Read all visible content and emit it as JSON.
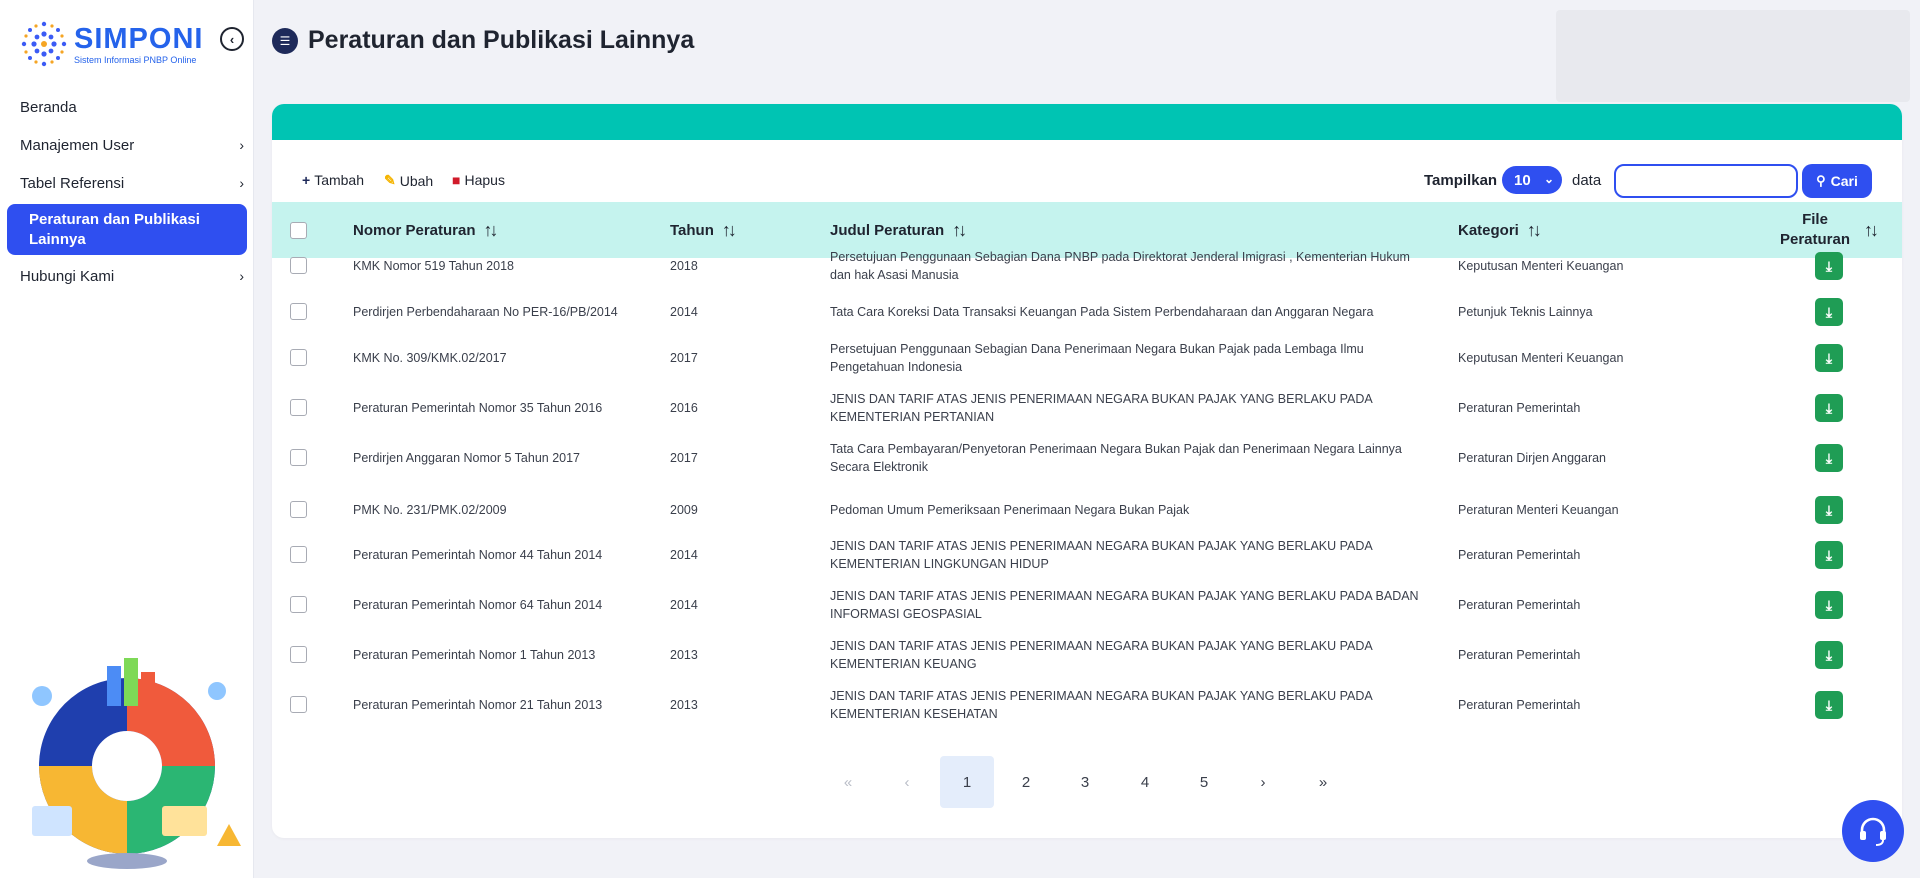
{
  "brand": {
    "title": "SIMPONI",
    "subtitle": "Sistem Informasi PNBP Online",
    "accent": "#2563eb"
  },
  "sidebar": {
    "items": [
      {
        "label": "Beranda",
        "has_submenu": false,
        "active": false
      },
      {
        "label": "Manajemen User",
        "has_submenu": true,
        "active": false
      },
      {
        "label": "Tabel Referensi",
        "has_submenu": true,
        "active": false
      },
      {
        "label": "Peraturan dan Publikasi Lainnya",
        "has_submenu": false,
        "active": true
      },
      {
        "label": "Hubungi Kami",
        "has_submenu": true,
        "active": false
      }
    ]
  },
  "page": {
    "title": "Peraturan dan Publikasi Lainnya",
    "icon": "list-icon"
  },
  "toolbar": {
    "add_label": "Tambah",
    "edit_label": "Ubah",
    "delete_label": "Hapus",
    "show_label": "Tampilkan",
    "page_size": "10",
    "data_label": "data",
    "search_value": "",
    "search_button": "Cari"
  },
  "table": {
    "columns": [
      "Nomor Peraturan",
      "Tahun",
      "Judul Peraturan",
      "Kategori",
      "File Peraturan"
    ],
    "rows": [
      {
        "nomor": "KMK Nomor 519 Tahun 2018",
        "tahun": "2018",
        "judul": "Persetujuan Penggunaan Sebagian Dana PNBP pada Direktorat Jenderal Imigrasi , Kementerian Hukum dan hak Asasi Manusia",
        "kategori": "Keputusan Menteri Keuangan"
      },
      {
        "nomor": "Perdirjen Perbendaharaan No PER-16/PB/2014",
        "tahun": "2014",
        "judul": "Tata Cara Koreksi Data Transaksi Keuangan Pada Sistem Perbendaharaan dan Anggaran Negara",
        "kategori": "Petunjuk Teknis Lainnya"
      },
      {
        "nomor": "KMK No. 309/KMK.02/2017",
        "tahun": "2017",
        "judul": "Persetujuan Penggunaan Sebagian Dana Penerimaan Negara Bukan Pajak pada Lembaga Ilmu Pengetahuan Indonesia",
        "kategori": "Keputusan Menteri Keuangan"
      },
      {
        "nomor": "Peraturan Pemerintah Nomor 35 Tahun 2016",
        "tahun": "2016",
        "judul": "JENIS DAN TARIF ATAS JENIS PENERIMAAN NEGARA BUKAN PAJAK YANG BERLAKU PADA KEMENTERIAN PERTANIAN",
        "kategori": "Peraturan Pemerintah"
      },
      {
        "nomor": "Perdirjen Anggaran Nomor 5 Tahun 2017",
        "tahun": "2017",
        "judul": "Tata Cara Pembayaran/Penyetoran Penerimaan Negara Bukan Pajak dan Penerimaan Negara Lainnya Secara Elektronik",
        "kategori": "Peraturan Dirjen Anggaran"
      },
      {
        "nomor": "PMK No. 231/PMK.02/2009",
        "tahun": "2009",
        "judul": "Pedoman Umum Pemeriksaan Penerimaan Negara Bukan Pajak",
        "kategori": "Peraturan Menteri Keuangan"
      },
      {
        "nomor": "Peraturan Pemerintah Nomor 44 Tahun 2014",
        "tahun": "2014",
        "judul": "JENIS DAN TARIF ATAS JENIS PENERIMAAN NEGARA BUKAN PAJAK YANG BERLAKU PADA KEMENTERIAN LINGKUNGAN HIDUP",
        "kategori": "Peraturan Pemerintah"
      },
      {
        "nomor": "Peraturan Pemerintah Nomor 64 Tahun 2014",
        "tahun": "2014",
        "judul": "JENIS DAN TARIF ATAS JENIS PENERIMAAN NEGARA BUKAN PAJAK YANG BERLAKU PADA BADAN INFORMASI GEOSPASIAL",
        "kategori": "Peraturan Pemerintah"
      },
      {
        "nomor": "Peraturan Pemerintah Nomor 1 Tahun 2013",
        "tahun": "2013",
        "judul": "JENIS DAN TARIF ATAS JENIS PENERIMAAN NEGARA BUKAN PAJAK YANG BERLAKU PADA KEMENTERIAN KEUANG",
        "kategori": "Peraturan Pemerintah"
      },
      {
        "nomor": "Peraturan Pemerintah Nomor 21 Tahun 2013",
        "tahun": "2013",
        "judul": "JENIS DAN TARIF ATAS JENIS PENERIMAAN NEGARA BUKAN PAJAK YANG BERLAKU PADA KEMENTERIAN KESEHATAN",
        "kategori": "Peraturan Pemerintah"
      }
    ]
  },
  "pagination": {
    "first": "«",
    "prev": "‹",
    "pages": [
      "1",
      "2",
      "3",
      "4",
      "5"
    ],
    "current": "1",
    "next": "›",
    "last": "»"
  },
  "colors": {
    "primary": "#2f4ff0",
    "band": "#00c4b3",
    "header_row": "#c5f3ee",
    "download": "#1f9d55"
  }
}
